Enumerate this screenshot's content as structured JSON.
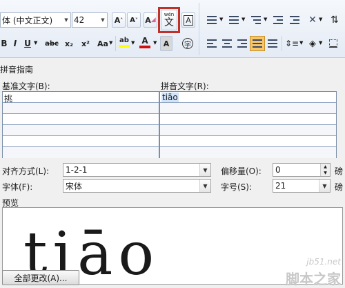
{
  "ribbon": {
    "font_name": "体 (中文正文)",
    "font_size": "42",
    "grow_font": "A",
    "shrink_font": "A",
    "clear_format": "A",
    "phonetic_guide_top": "wén",
    "phonetic_guide_char": "文",
    "char_border": "A",
    "bold": "B",
    "italic": "I",
    "underline": "U",
    "strikethrough": "abc",
    "subscript": "x₂",
    "superscript": "x²",
    "change_case": "Aa",
    "highlight": "ab",
    "font_color": "A",
    "enclose_char": "字",
    "accent_red": "#c2302a",
    "highlight_yellow": "#ffff00",
    "font_red": "#d01010",
    "active_orange": "#f7c66b"
  },
  "dialog": {
    "title": "拼音指南",
    "base_text_label": "基准文字(B):",
    "ruby_text_label": "拼音文字(R):",
    "base_rows": [
      "挑",
      "",
      "",
      "",
      "",
      ""
    ],
    "ruby_rows": [
      "tiāo",
      "",
      "",
      "",
      "",
      ""
    ],
    "alignment_label": "对齐方式(L):",
    "alignment_value": "1-2-1",
    "offset_label": "偏移量(O):",
    "offset_value": "0",
    "offset_unit": "磅",
    "font_label": "字体(F):",
    "font_value": "宋体",
    "size_label": "字号(S):",
    "size_value": "21",
    "size_unit": "磅",
    "preview_label": "预览",
    "preview_text": "tiāo",
    "apply_all_button": "全部更改(A)...",
    "watermark_url": "jb51.net",
    "watermark_text": "脚本之家"
  }
}
